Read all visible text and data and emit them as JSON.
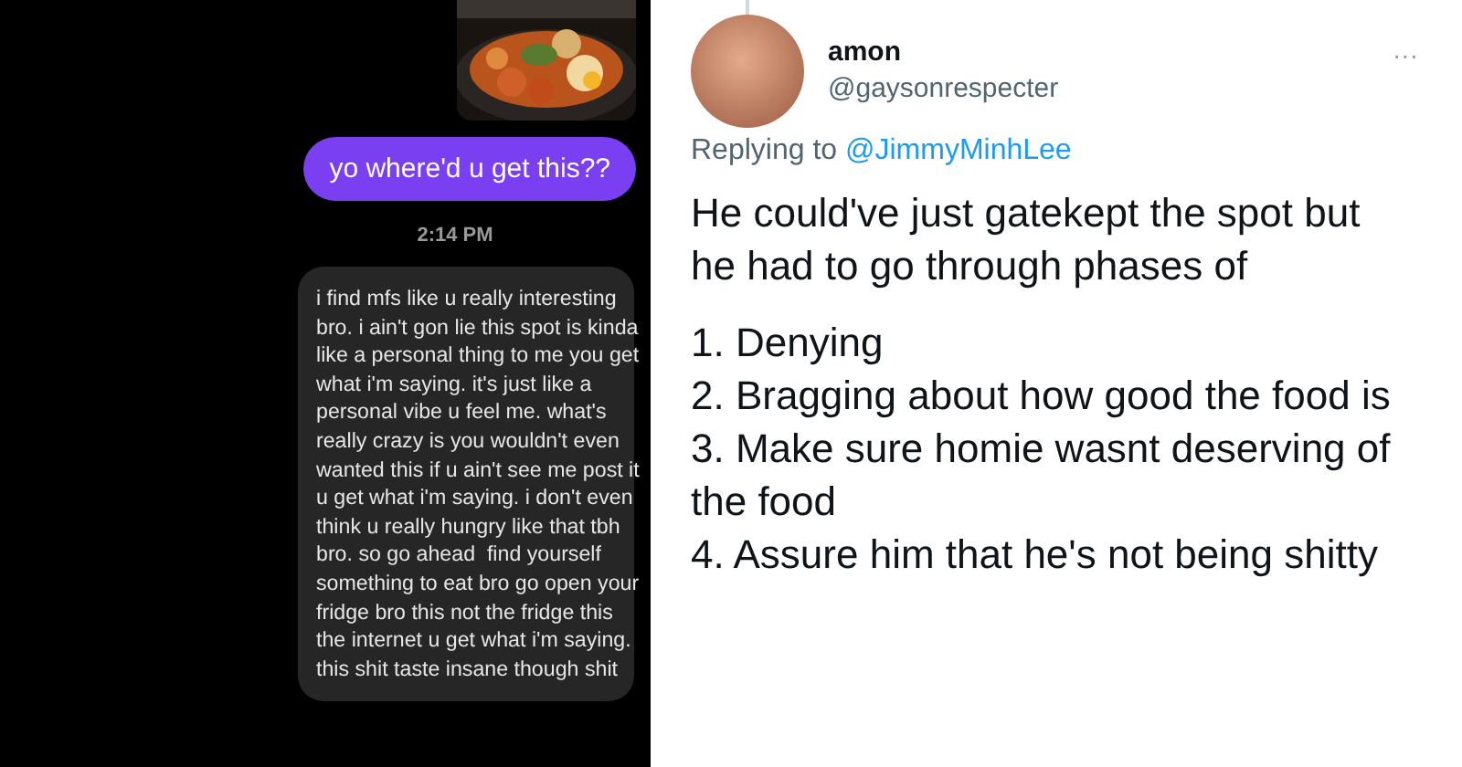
{
  "chat": {
    "sent_message": "yo where'd u get this??",
    "timestamp": "2:14 PM",
    "received_message": "i find mfs like u really interesting\nbro. i ain't gon lie this spot is kinda\nlike a personal thing to me you get\nwhat i'm saying. it's just like a\npersonal vibe u feel me. what's\nreally crazy is you wouldn't even\nwanted this if u ain't see me post it\nu get what i'm saying. i don't even\nthink u really hungry like that tbh\nbro. so go ahead  find yourself\nsomething to eat bro go open your\nfridge bro this not the fridge this\nthe internet u get what i'm saying.\nthis shit taste insane though shit"
  },
  "tweet": {
    "display_name": "amon",
    "handle": "@gaysonrespecter",
    "more": "···",
    "replying_prefix": "Replying to",
    "replying_to": "@JimmyMinhLee",
    "paragraphs": [
      "He could've just gatekept the spot but he had to go through phases of",
      "1. Denying",
      "2. Bragging about how good the food is",
      "3. Make sure homie wasnt deserving of the food",
      "4. Assure him that he's not being shitty"
    ]
  }
}
